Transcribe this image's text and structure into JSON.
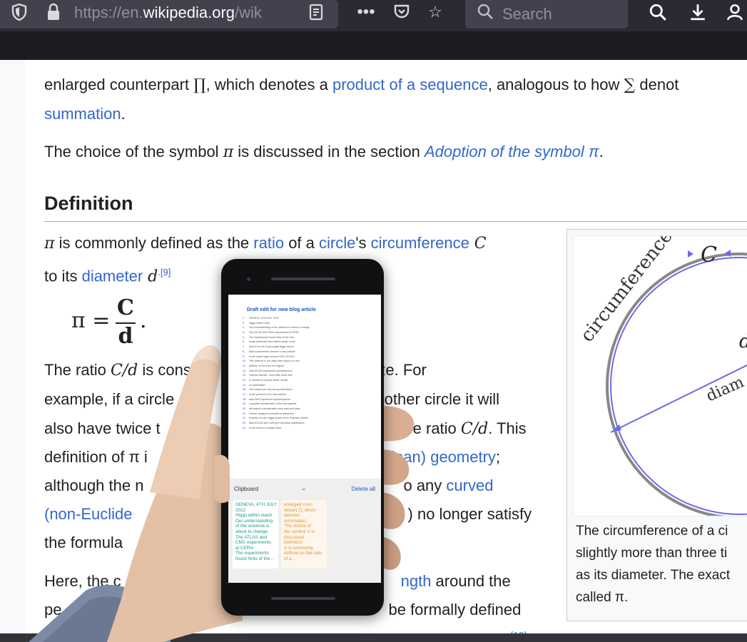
{
  "browser": {
    "url_prefix": "https://en.",
    "url_domain": "wikipedia.org",
    "url_suffix": "/wik",
    "search_placeholder": "Search"
  },
  "article": {
    "line1_a": "enlarged counterpart ",
    "line1_symbol": "∏",
    "line1_b": ", which denotes a ",
    "line1_link": "product of a sequence",
    "line1_c": ", analogous to how ",
    "line1_sum": "∑",
    "line1_d": " denot",
    "line2_link": "summation",
    "line2_end": ".",
    "line3_a": "The choice of the symbol ",
    "line3_pi": "π",
    "line3_b": " is discussed in the section ",
    "line3_link": "Adoption of the symbol π",
    "line3_end": ".",
    "heading": "Definition",
    "def1_pi": "π",
    "def1_a": " is commonly defined as the ",
    "def1_ratio": "ratio",
    "def1_b": " of a ",
    "def1_circle": "circle",
    "def1_c": "'s ",
    "def1_circumference": "circumference",
    "def1_C": " C",
    "def2_a": "to its ",
    "def2_diameter": "diameter",
    "def2_d": " d",
    "def2_ref": ".[9]",
    "formula_lhs": "π =",
    "formula_num": "C",
    "formula_den": "d",
    "formula_dot": ".",
    "p1_a": "The ratio ",
    "p1_ratio": "C/d",
    "p1_b": " is cons",
    "p1_c": "ircle's size. For",
    "p2_a": "example, if a circle",
    "p2_b": "another circle it will",
    "p3_a": "also have twice t",
    "p3_b": "e ratio ",
    "p3_ratio": "C/d",
    "p3_c": ". This",
    "p4_a": "definition of π i",
    "p4_link": "dean) geometry",
    "p4_b": ";",
    "p5_a": "although the n",
    "p5_b": "o any ",
    "p5_link": "curved",
    "p6_link": "(non-Euclide",
    "p6_b": ") no longer satisfy",
    "p7_a": "the formula",
    "p8_a": "Here, the c",
    "p8_link": "ngth",
    "p8_b": " around the",
    "p9_a": "pe",
    "p9_b": "be formally defined",
    "p10_ref": "[10]"
  },
  "figure": {
    "label_circumference": "circumference",
    "label_C": "C",
    "label_d": "d",
    "label_diameter": "diam",
    "caption_lines": [
      "The circumference of a ci",
      "slightly more than three ti",
      "as its diameter. The exact",
      "called π."
    ]
  },
  "phone": {
    "doc_title": "Draft edit for new blog article",
    "doc_lines": [
      {
        "n": "1.",
        "t": "GENEVA, 4TH JULY 2012"
      },
      {
        "n": "2.",
        "t": "Higgs within reach"
      },
      {
        "n": "3.",
        "t": "Our understanding of the universe is about to change"
      },
      {
        "n": "4.",
        "t": "The ATLAS and CMS experiments at CERN"
      },
      {
        "n": "5.",
        "t": "The experiments found hints of the new"
      },
      {
        "n": "6.",
        "t": "today presented their latest results in the"
      },
      {
        "n": "7.",
        "t": "search for the long-sought Higgs boson"
      },
      {
        "n": "8.",
        "t": "Both experiments observe a new particle"
      },
      {
        "n": "9.",
        "t": "in the mass region around 125-126 GeV"
      },
      {
        "n": "10.",
        "t": "\"We observe in our data clear signs of a new"
      },
      {
        "n": "11.",
        "t": "particle, at the level of 5 sigma\""
      },
      {
        "n": "12.",
        "t": "said ATLAS experiment spokesperson"
      },
      {
        "n": "13.",
        "t": "Fabiola Gianotti, \"but a little more time"
      },
      {
        "n": "14.",
        "t": "is needed to prepare these results"
      },
      {
        "n": "15.",
        "t": "for publication\""
      },
      {
        "n": "16.",
        "t": "The results are very strong indications"
      },
      {
        "n": "17.",
        "t": "of the presence of a new particle"
      },
      {
        "n": "18.",
        "t": "said CMS experiment spokesperson"
      },
      {
        "n": "19.",
        "t": "A positive identification of the new particle"
      },
      {
        "n": "20.",
        "t": "will require considerable more work and data"
      },
      {
        "n": "21.",
        "t": "Further analysis is needed to determine"
      },
      {
        "n": "22.",
        "t": "whether it is the Higgs boson of the Standard Model"
      },
      {
        "n": "23.",
        "t": "Both ATLAS and CMS give technical significance"
      },
      {
        "n": "24.",
        "t": "to the result in a single week"
      }
    ],
    "clipboard_title": "Clipboard",
    "clipboard_delete": "Delete all",
    "clip1_text": "GENEVA, 4TH JULY\n2012\nHiggs within reach\nOur understanding\nof the universe is\nabout to change\nThe ATLAS and\nCMS experiments\nat CERN\nThe experiments\nfound hints of the...",
    "clip2_text": "enlarged coun\nterpart ∏, which\ndenotes\nsummation.\nThe choice of\nthe symbol π is\ndiscussed\nDefinition\nπ is commonly\ndefined as the ratio\nof a..."
  },
  "colors": {
    "link": "#3366cc",
    "text": "#202122",
    "clip1": "#1a9c7c",
    "clip2": "#e8912c"
  }
}
